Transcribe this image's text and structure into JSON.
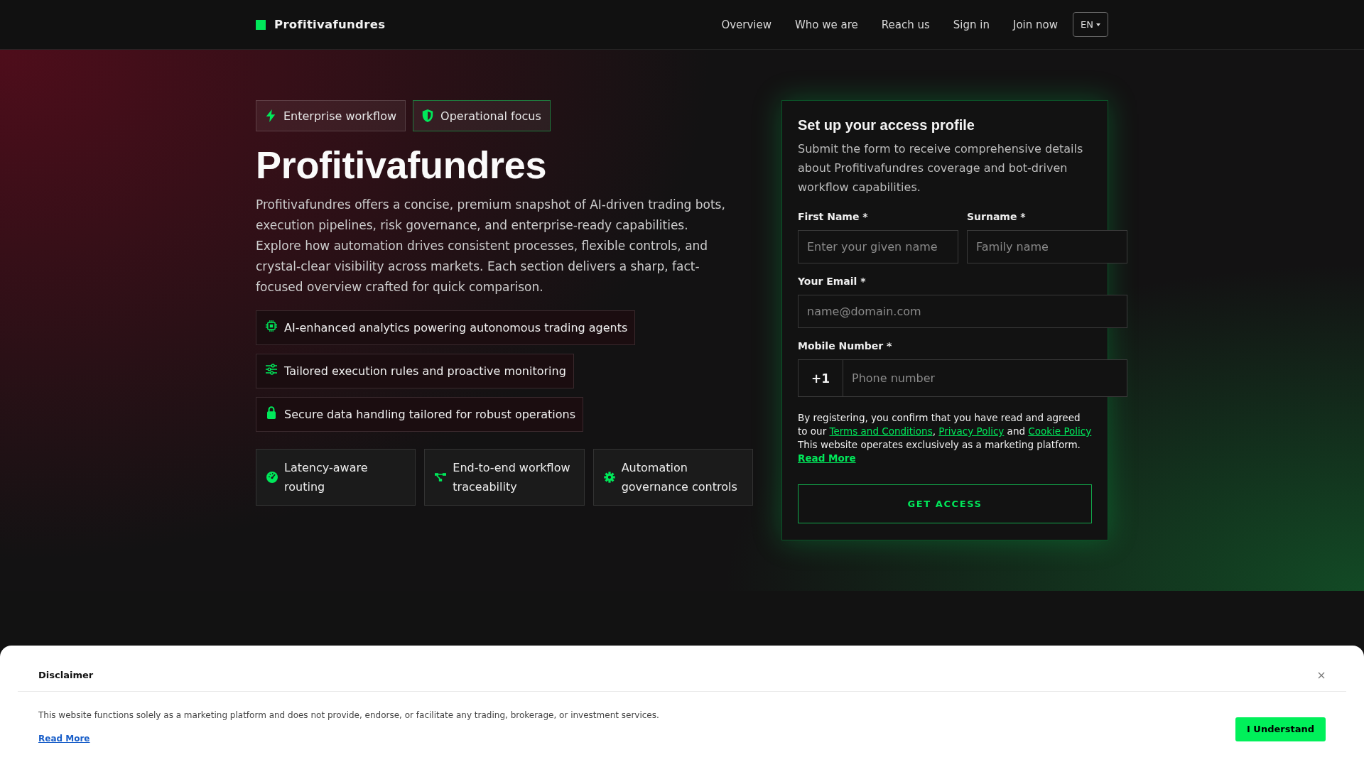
{
  "header": {
    "brand": "Profitivafundres",
    "nav": [
      {
        "label": "Overview"
      },
      {
        "label": "Who we are"
      },
      {
        "label": "Reach us"
      },
      {
        "label": "Sign in"
      },
      {
        "label": "Join now"
      }
    ],
    "language": {
      "label": "EN"
    }
  },
  "hero": {
    "badges": [
      {
        "label": "Enterprise workflow",
        "kind": "bolt",
        "highlighted": false
      },
      {
        "label": "Operational focus",
        "kind": "shield",
        "highlighted": true
      }
    ],
    "title": "Profitivafundres",
    "description": "Profitivafundres offers a concise, premium snapshot of AI-driven trading bots, execution pipelines, risk governance, and enterprise-ready capabilities. Explore how automation drives consistent processes, flexible controls, and crystal-clear visibility across markets. Each section delivers a sharp, fact-focused overview crafted for quick comparison.",
    "highlights": [
      {
        "text": "AI-enhanced analytics powering autonomous trading agents",
        "kind": "chip"
      },
      {
        "text": "Tailored execution rules and proactive monitoring",
        "kind": "sliders"
      },
      {
        "text": "Secure data handling tailored for robust operations",
        "kind": "lock"
      }
    ],
    "cards": [
      {
        "text": "Latency-aware routing",
        "kind": "gauge"
      },
      {
        "text": "End-to-end workflow traceability",
        "kind": "network"
      },
      {
        "text": "Automation governance controls",
        "kind": "gear"
      }
    ]
  },
  "form": {
    "title": "Set up your access profile",
    "description": "Submit the form to receive comprehensive details about Profitivafundres coverage and bot-driven workflow capabilities.",
    "rows": [
      [
        {
          "label": "First Name *",
          "placeholder": "Enter your given name",
          "kind": "text"
        },
        {
          "label": "Surname *",
          "placeholder": "Family name",
          "kind": "text"
        }
      ],
      [
        {
          "label": "Your Email *",
          "placeholder": "name@domain.com",
          "kind": "text"
        }
      ],
      [
        {
          "label": "Mobile Number *",
          "prefix": "+1",
          "placeholder": "Phone number",
          "kind": "phone"
        }
      ]
    ],
    "consent": [
      {
        "kind": "text",
        "text": "By registering, you confirm that you have read and agreed to our "
      },
      {
        "kind": "link",
        "text": "Terms and Conditions"
      },
      {
        "kind": "text",
        "text": ", "
      },
      {
        "kind": "link",
        "text": "Privacy Policy"
      },
      {
        "kind": "text",
        "text": " and "
      },
      {
        "kind": "link",
        "text": "Cookie Policy"
      },
      {
        "kind": "text",
        "text": " This website operates exclusively as a marketing platform. "
      },
      {
        "kind": "strong-link",
        "text": "Read More"
      }
    ],
    "submit": "GET ACCESS"
  },
  "disclaimer": {
    "title": "Disclaimer",
    "text": "This website functions solely as a marketing platform and does not provide, endorse, or facilitate any trading, brokerage, or investment services.",
    "link": "Read More",
    "button": "I Understand"
  }
}
